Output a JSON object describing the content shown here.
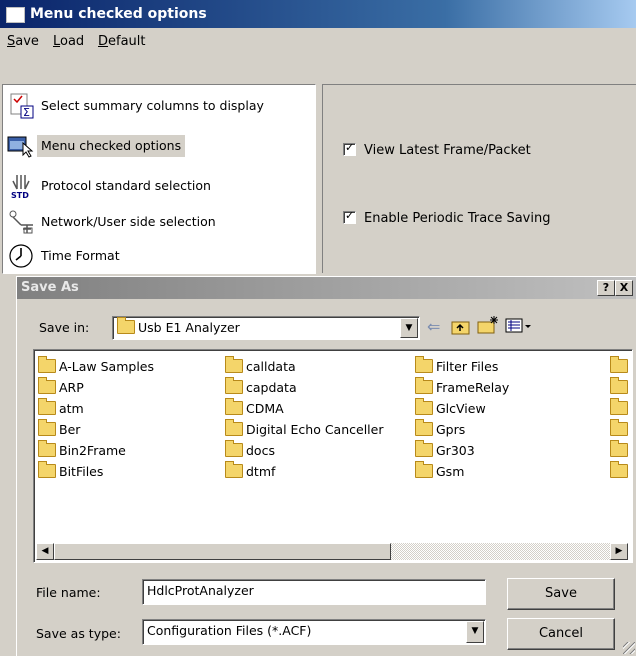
{
  "window": {
    "title": "Menu checked options",
    "menu": [
      "Save",
      "Load",
      "Default"
    ]
  },
  "options_list": [
    {
      "label": "Select summary columns to display",
      "icon": "summary-columns-icon",
      "selected": false
    },
    {
      "label": "Menu checked options",
      "icon": "menu-options-icon",
      "selected": true
    },
    {
      "label": "Protocol standard selection",
      "icon": "std-icon",
      "selected": false
    },
    {
      "label": "Network/User side selection",
      "icon": "network-icon",
      "selected": false
    },
    {
      "label": "Time Format",
      "icon": "clock-icon",
      "selected": false
    }
  ],
  "checkboxes": [
    {
      "label": "View Latest Frame/Packet",
      "checked": true
    },
    {
      "label": "Enable Periodic Trace Saving",
      "checked": true
    }
  ],
  "dialog": {
    "title": "Save As",
    "help_btn": "?",
    "close_btn": "X",
    "save_in_label": "Save in:",
    "save_in_value": "Usb E1 Analyzer",
    "file_columns": [
      [
        "A-Law Samples",
        "ARP",
        "atm",
        "Ber",
        "Bin2Frame",
        "BitFiles"
      ],
      [
        "calldata",
        "capdata",
        "CDMA",
        "Digital Echo Canceller",
        "docs",
        "dtmf"
      ],
      [
        "Filter Files",
        "FrameRelay",
        "GlcView",
        "Gprs",
        "Gr303",
        "Gsm"
      ]
    ],
    "file_name_label": "File name:",
    "file_name_value": "HdlcProtAnalyzer",
    "save_type_label": "Save as type:",
    "save_type_value": "Configuration Files (*.ACF)",
    "save_button": "Save",
    "cancel_button": "Cancel"
  },
  "colors": {
    "titlebar_active": "#0a246a",
    "titlebar_inactive": "#808080",
    "face": "#d4d0c8",
    "folder": "#f4d56a"
  }
}
